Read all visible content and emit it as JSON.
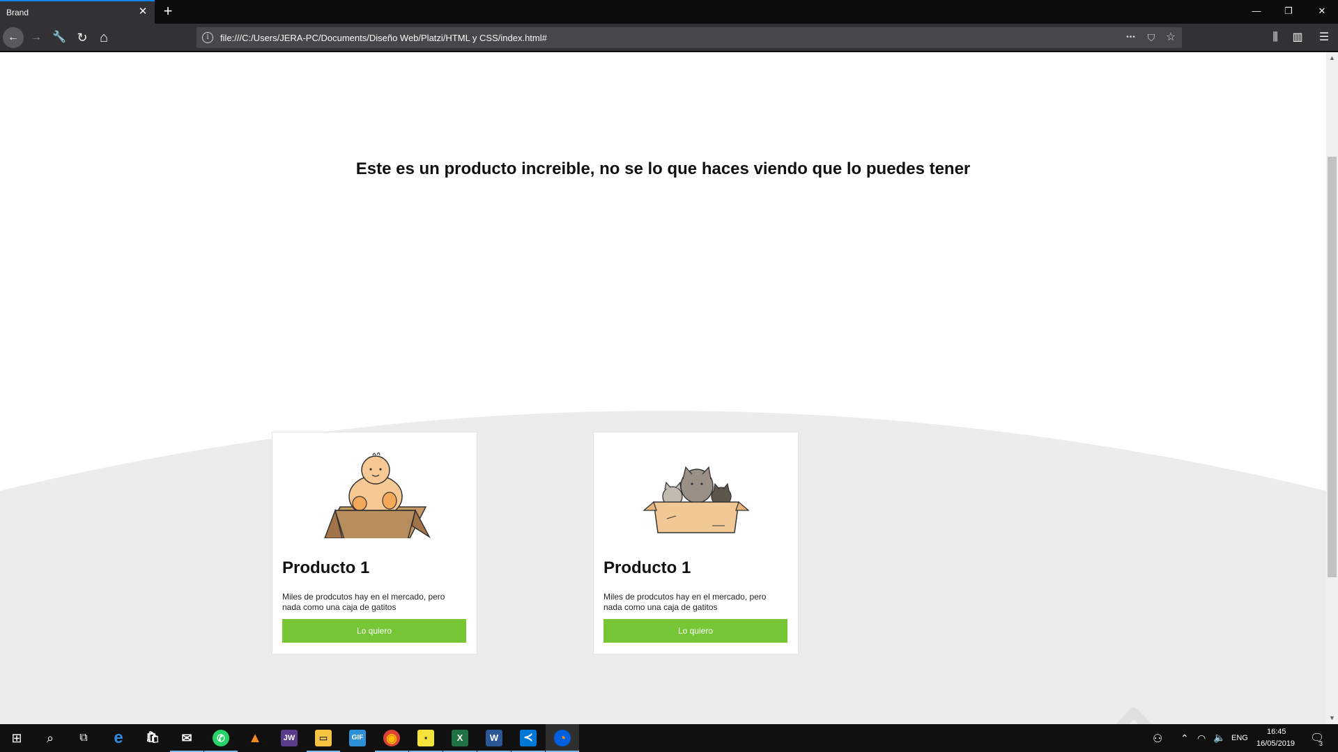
{
  "browser": {
    "tab_title": "Brand",
    "tab_close": "✕",
    "new_tab": "+",
    "window_controls": {
      "minimize": "—",
      "restore": "❐",
      "close": "✕"
    },
    "nav": {
      "back": "←",
      "forward": "→",
      "tools": "🔧",
      "reload": "↻",
      "home": "⌂"
    },
    "url": "file:///C:/Users/JERA-PC/Documents/Diseño Web/Platzi/HTML y CSS/index.html#",
    "url_info": "i",
    "url_actions": {
      "more": "•••",
      "pocket": "⛉",
      "bookmark": "☆"
    },
    "toolbar": {
      "library": "⫼",
      "sidebar": "▥",
      "menu": "☰"
    }
  },
  "page": {
    "hero_title": "Este es un producto increible, no se lo que haces viendo que lo puedes tener",
    "products": [
      {
        "title": "Producto 1",
        "description": "Miles de prodcutos hay en el mercado, pero nada como una caja de gatitos",
        "button": "Lo quiero",
        "image": "baby-in-box-illustration"
      },
      {
        "title": "Producto 1",
        "description": "Miles de prodcutos hay en el mercado, pero nada como una caja de gatitos",
        "button": "Lo quiero",
        "image": "cats-in-box-illustration"
      }
    ],
    "watermark": "Platzi",
    "colors": {
      "button_green": "#76c635",
      "curve_gray": "#ececec"
    }
  },
  "taskbar": {
    "apps": [
      {
        "name": "windows-start",
        "glyph": "⊞"
      },
      {
        "name": "search",
        "glyph": "⌕"
      },
      {
        "name": "task-view",
        "glyph": "⧉"
      },
      {
        "name": "edge",
        "glyph": "e"
      },
      {
        "name": "store",
        "glyph": "🛍"
      },
      {
        "name": "mail",
        "glyph": "✉"
      },
      {
        "name": "whatsapp",
        "glyph": "✆"
      },
      {
        "name": "vlc",
        "glyph": "▲"
      },
      {
        "name": "jw-player",
        "glyph": "JW"
      },
      {
        "name": "file-explorer",
        "glyph": "▭"
      },
      {
        "name": "gif-app",
        "glyph": "GIF"
      },
      {
        "name": "chrome",
        "glyph": "◉"
      },
      {
        "name": "sticky-notes",
        "glyph": "▪"
      },
      {
        "name": "excel",
        "glyph": "X"
      },
      {
        "name": "word",
        "glyph": "W"
      },
      {
        "name": "vscode",
        "glyph": "≺"
      },
      {
        "name": "firefox",
        "glyph": "◔"
      }
    ],
    "tray": {
      "language": "ENG",
      "time": "16:45",
      "date": "16/05/2019",
      "notifications": "3"
    }
  }
}
